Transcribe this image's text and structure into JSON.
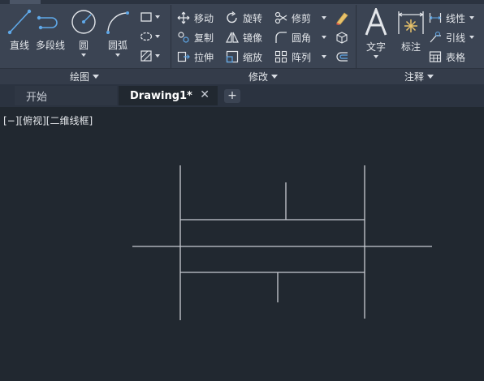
{
  "ribbon": {
    "panels": {
      "draw": "绘图",
      "modify": "修改",
      "annotate": "注释"
    },
    "draw_tools": {
      "line": "直线",
      "polyline": "多段线",
      "circle": "圆",
      "arc": "圆弧"
    },
    "modify_tools": {
      "move": "移动",
      "rotate": "旋转",
      "trim": "修剪",
      "copy": "复制",
      "mirror": "镜像",
      "fillet": "圆角",
      "stretch": "拉伸",
      "scale": "缩放",
      "array": "阵列"
    },
    "annotate_tools": {
      "text": "文字",
      "dimension": "标注",
      "linear": "线性",
      "leader": "引线",
      "table": "表格"
    }
  },
  "tabs": {
    "start": "开始",
    "drawing": "Drawing1*",
    "close_symbol": "✕",
    "add_symbol": "+"
  },
  "viewport": {
    "label": "[−][俯视][二维线框]"
  },
  "colors": {
    "ribbon_bg": "#3b4453",
    "canvas_bg": "#212830",
    "line_color": "#c8ccd2",
    "accent_blue": "#5fa8e8"
  }
}
